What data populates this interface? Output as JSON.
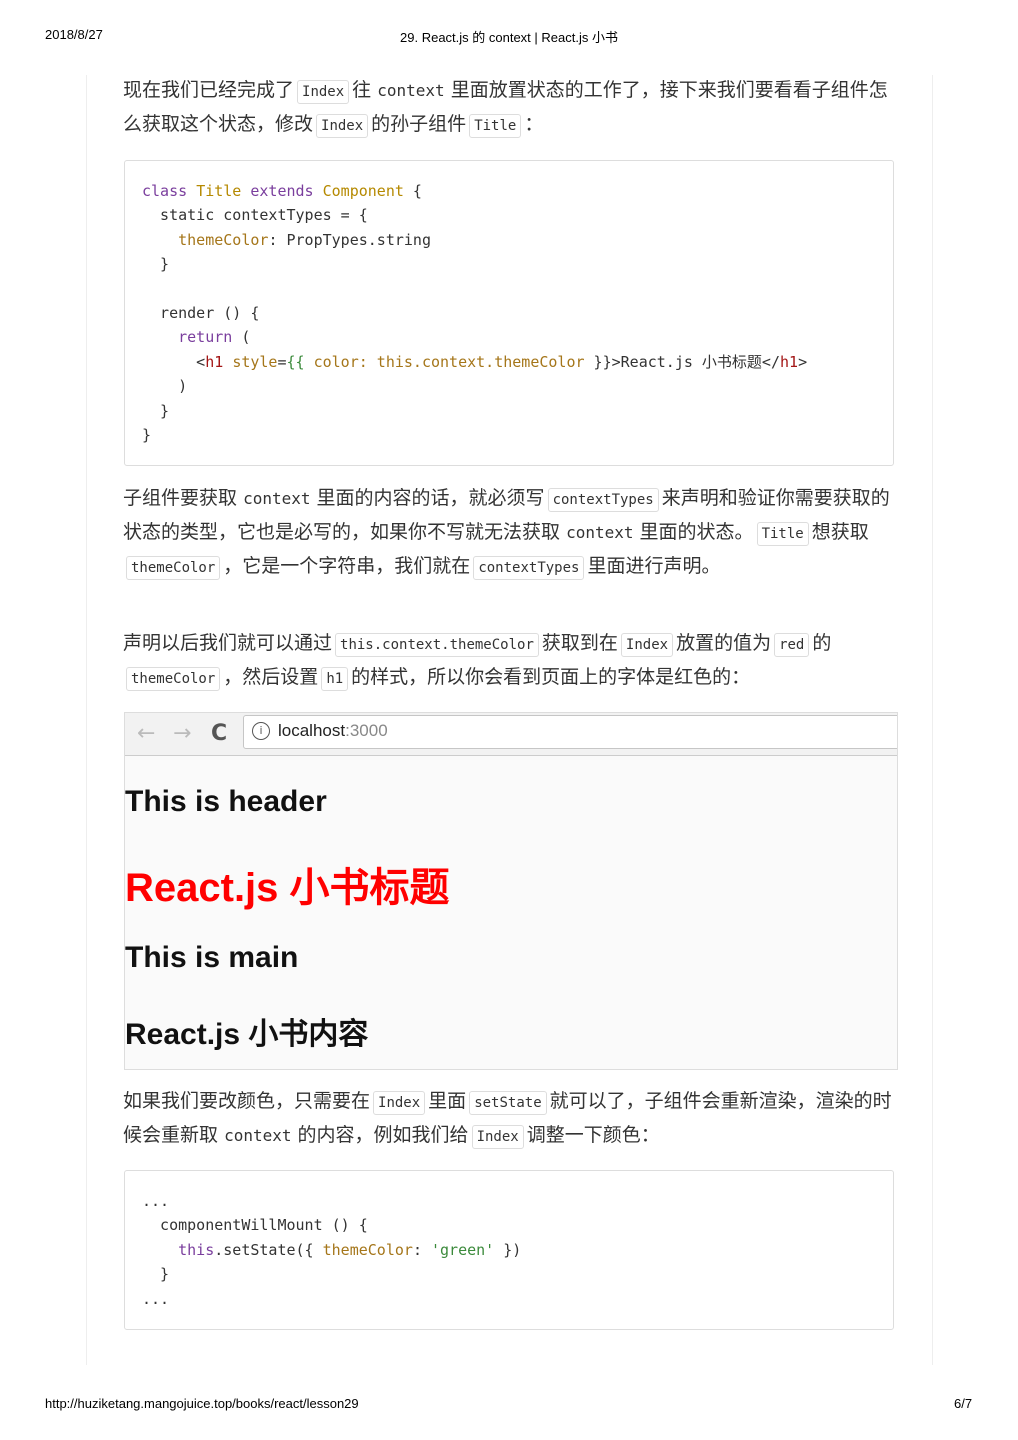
{
  "header": {
    "date": "2018/8/27",
    "title": "29. React.js 的 context | React.js 小书"
  },
  "footer": {
    "url": "http://huziketang.mangojuice.top/books/react/lesson29",
    "page": "6/7"
  },
  "p1": {
    "a": "现在我们已经完成了",
    "b": "Index",
    "c": "往",
    "d": "context",
    "e": "里面放置状态的工作了，接下来我们要看看子组件怎么获取这个状态，修改",
    "f": "Index",
    "g": "的孙子组件",
    "h": "Title",
    "i": "："
  },
  "p2": {
    "a": "子组件要获取",
    "b": "context",
    "c": "里面的内容的话，就必须写",
    "d": "contextTypes",
    "e": "来声明和验证你需要获取的状态的类型，它也是必写的，如果你不写就无法获取",
    "f": "context",
    "g": "里面的状态。",
    "h": "Title",
    "i": "想获取",
    "j": "themeColor",
    "k": "，它是一个字符串，我们就在",
    "l": "contextTypes",
    "m": "里面进行声明。"
  },
  "p3": {
    "a": "声明以后我们就可以通过",
    "b": "this.context.themeColor",
    "c": "获取到在",
    "d": "Index",
    "e": "放置的值为",
    "f": "red",
    "g": "的",
    "h": "themeColor",
    "i": "，然后设置",
    "j": "h1",
    "k": "的样式，所以你会看到页面上的字体是红色的："
  },
  "p4": {
    "a": "如果我们要改颜色，只需要在",
    "b": "Index",
    "c": "里面",
    "d": "setState",
    "e": "就可以了，子组件会重新渲染，渲染的时候会重新取",
    "f": "context",
    "g": "的内容，例如我们给",
    "h": "Index",
    "i": "调整一下颜色："
  },
  "code1": {
    "l1": [
      "class",
      "Title",
      "extends",
      "Component",
      " {"
    ],
    "l2": "  static contextTypes = {",
    "l3": [
      "    ",
      "themeColor",
      ": PropTypes.string"
    ],
    "l4": "  }",
    "l6": "  render () {",
    "l7": [
      "    ",
      "return",
      " ("
    ],
    "l8": [
      "      <",
      "h1",
      " ",
      "style",
      "=",
      "{{",
      " ",
      "color: this.context.themeColor",
      " }}>React.js 小书标题</",
      "h1",
      ">"
    ],
    "l9": "    )",
    "l10": "  }",
    "l11": "}"
  },
  "code2": {
    "l1": "...",
    "l2": "  componentWillMount () {",
    "l3": [
      "    ",
      "this",
      ".setState({ ",
      "themeColor",
      ": ",
      "'green'",
      " })"
    ],
    "l4": "  }",
    "l5": "..."
  },
  "screenshot": {
    "back": "←",
    "forward": "→",
    "reload": "C",
    "info": "i",
    "host": "localhost",
    "port": ":3000",
    "h_header": "This is header",
    "h_title": "React.js 小书标题",
    "title_color": "#ff0000",
    "h_main": "This is main",
    "h_content": "React.js 小书内容"
  }
}
